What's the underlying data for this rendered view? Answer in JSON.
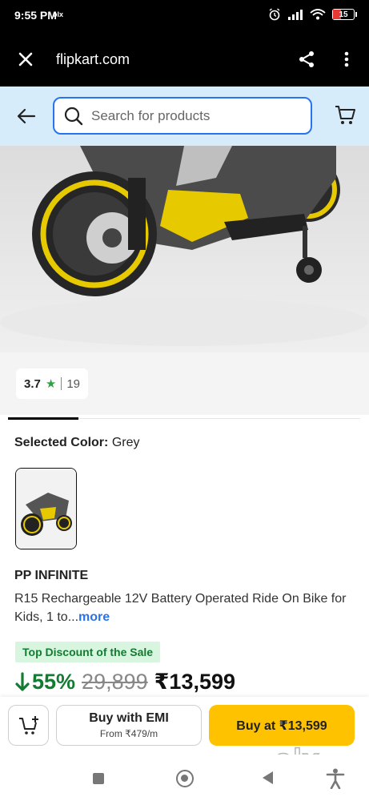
{
  "status_bar": {
    "time": "9:55 PM",
    "small_label": "olx",
    "battery": "15"
  },
  "browser": {
    "url": "flipkart.com"
  },
  "search": {
    "placeholder": "Search for products"
  },
  "rating": {
    "value": "3.7",
    "star": "★",
    "count": "19"
  },
  "selected_color": {
    "label": "Selected Color:",
    "value": "Grey"
  },
  "product": {
    "brand": "PP INFINITE",
    "title": "R15 Rechargeable 12V Battery Operated Ride On Bike for Kids, 1 to...",
    "more": "more",
    "discount_badge": "Top Discount of the Sale",
    "discount_pct": "55%",
    "mrp": "29,899",
    "price": "₹13,599"
  },
  "actions": {
    "emi_title": "Buy with EMI",
    "emi_sub": "From ₹479/m",
    "buy_label": "Buy at ₹13,599"
  },
  "watermark": "olx",
  "colors": {
    "brand_blue": "#2874f0",
    "buy_yellow": "#ffc200",
    "discount_green": "#137b32",
    "header_bg": "#d6ecfa"
  }
}
